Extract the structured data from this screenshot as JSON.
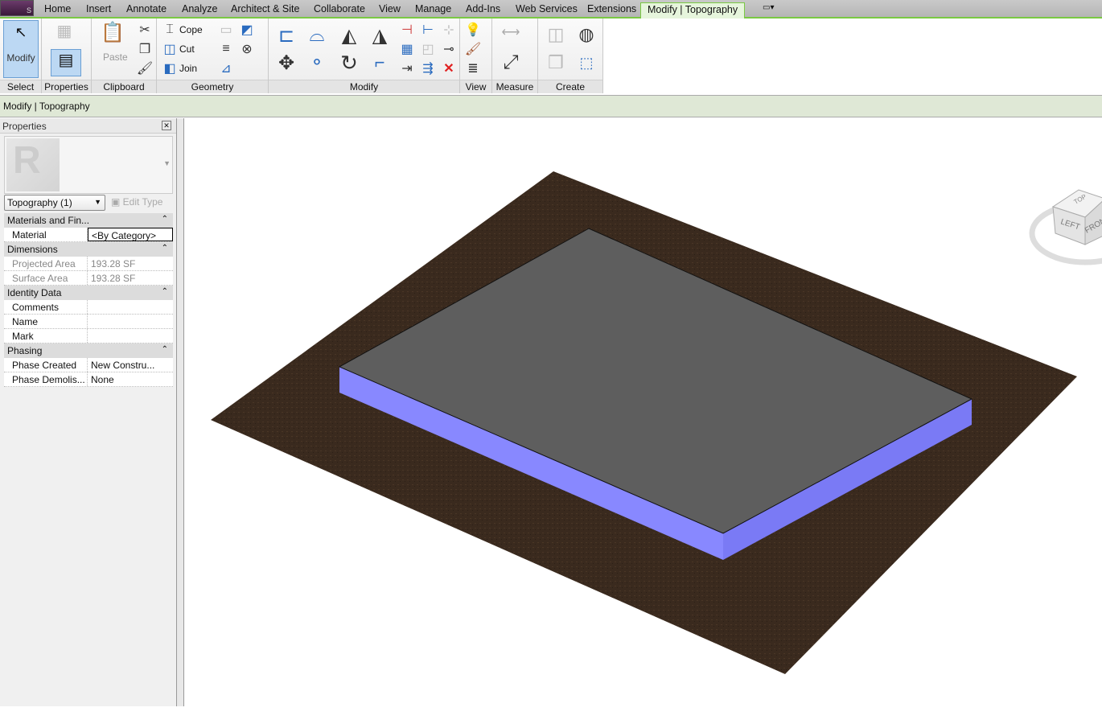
{
  "app": {
    "button_label": "S"
  },
  "tabs": [
    "Home",
    "Insert",
    "Annotate",
    "Analyze",
    "Architect & Site",
    "Collaborate",
    "View",
    "Manage",
    "Add-Ins",
    "Web Services",
    "Extensions",
    "Modify | Topography"
  ],
  "ribbon": {
    "panels": [
      "Select",
      "Properties",
      "Clipboard",
      "Geometry",
      "Modify",
      "View",
      "Measure",
      "Create"
    ],
    "modify_label": "Modify",
    "paste_label": "Paste",
    "cope_label": "Cope",
    "cut_label": "Cut",
    "join_label": "Join"
  },
  "context_bar": "Modify | Topography",
  "properties": {
    "title": "Properties",
    "type_selector": "Topography (1)",
    "edit_type": "Edit Type",
    "sections": [
      {
        "name": "Materials and Fin...",
        "rows": [
          {
            "k": "Material",
            "v": "<By Category>"
          }
        ]
      },
      {
        "name": "Dimensions",
        "rows": [
          {
            "k": "Projected Area",
            "v": "193.28 SF"
          },
          {
            "k": "Surface Area",
            "v": "193.28 SF"
          }
        ]
      },
      {
        "name": "Identity Data",
        "rows": [
          {
            "k": "Comments",
            "v": ""
          },
          {
            "k": "Name",
            "v": ""
          },
          {
            "k": "Mark",
            "v": ""
          }
        ]
      },
      {
        "name": "Phasing",
        "rows": [
          {
            "k": "Phase Created",
            "v": "New Constru..."
          },
          {
            "k": "Phase Demolis...",
            "v": "None"
          }
        ]
      }
    ]
  },
  "viewcube": {
    "top": "TOP",
    "left": "LEFT",
    "front": "FRONT"
  },
  "colors": {
    "terrain": "#3a2a1e",
    "pad_top": "#5e5e5e",
    "pad_side": "#8080ff",
    "ribbon_accent": "#7ac943"
  }
}
